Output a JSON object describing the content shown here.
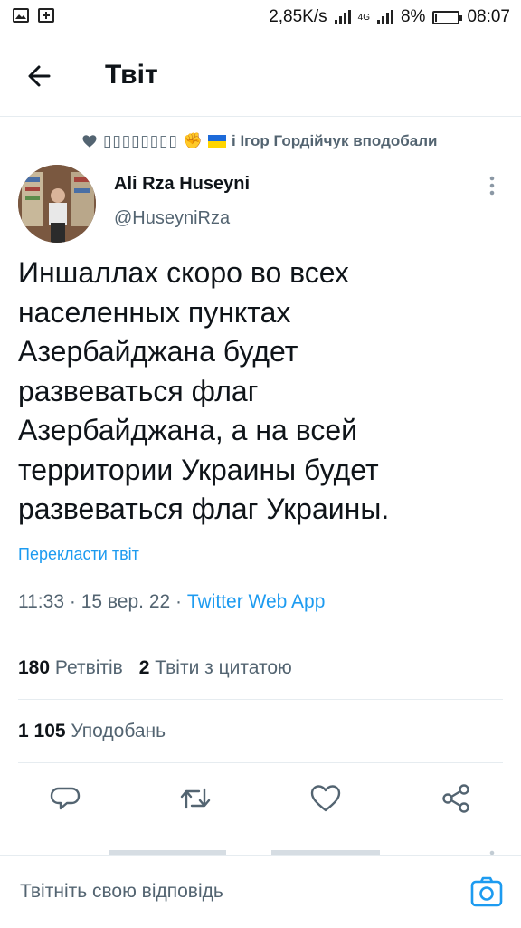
{
  "status_bar": {
    "speed": "2,85K/s",
    "network": "4G",
    "battery": "8%",
    "battery_level": 0.08,
    "time": "08:07"
  },
  "header": {
    "title": "Твіт",
    "back_icon": "arrow-left-icon"
  },
  "liked_by": {
    "name_placeholder": "▯▯▯▯▯▯▯▯",
    "fist_emoji": "✊",
    "text": "і Ігор Гордійчук вподобали",
    "flag_colors": [
      "#1d6ad9",
      "#ffd500"
    ]
  },
  "tweet": {
    "author_name": "Ali Rza Huseyni",
    "author_handle": "@HuseyniRza",
    "text_lines": [
      "Иншаллах скоро во всех",
      "населенных пунктах",
      "Азербайджана будет",
      "развеваться флаг",
      "Азербайджана, а на всей",
      "территории Украины будет",
      "развеваться флаг Украины."
    ],
    "translate_label": "Перекласти твіт",
    "time": "11:33",
    "date": "15 вер. 22",
    "separator": "·",
    "app": "Twitter Web App"
  },
  "stats": {
    "retweets_count": "180",
    "retweets_label": "Ретвітів",
    "quotes_count": "2",
    "quotes_label": "Твіти з цитатою",
    "likes_count": "1 105",
    "likes_label": "Уподобань"
  },
  "actions": [
    "reply-icon",
    "retweet-icon",
    "like-icon",
    "share-icon"
  ],
  "reply_bar": {
    "placeholder": "Твітніть свою відповідь",
    "camera_icon": "camera-icon"
  },
  "colors": {
    "accent": "#1d9bf0",
    "secondary_text": "#536471",
    "divider": "#e6ecf0"
  }
}
